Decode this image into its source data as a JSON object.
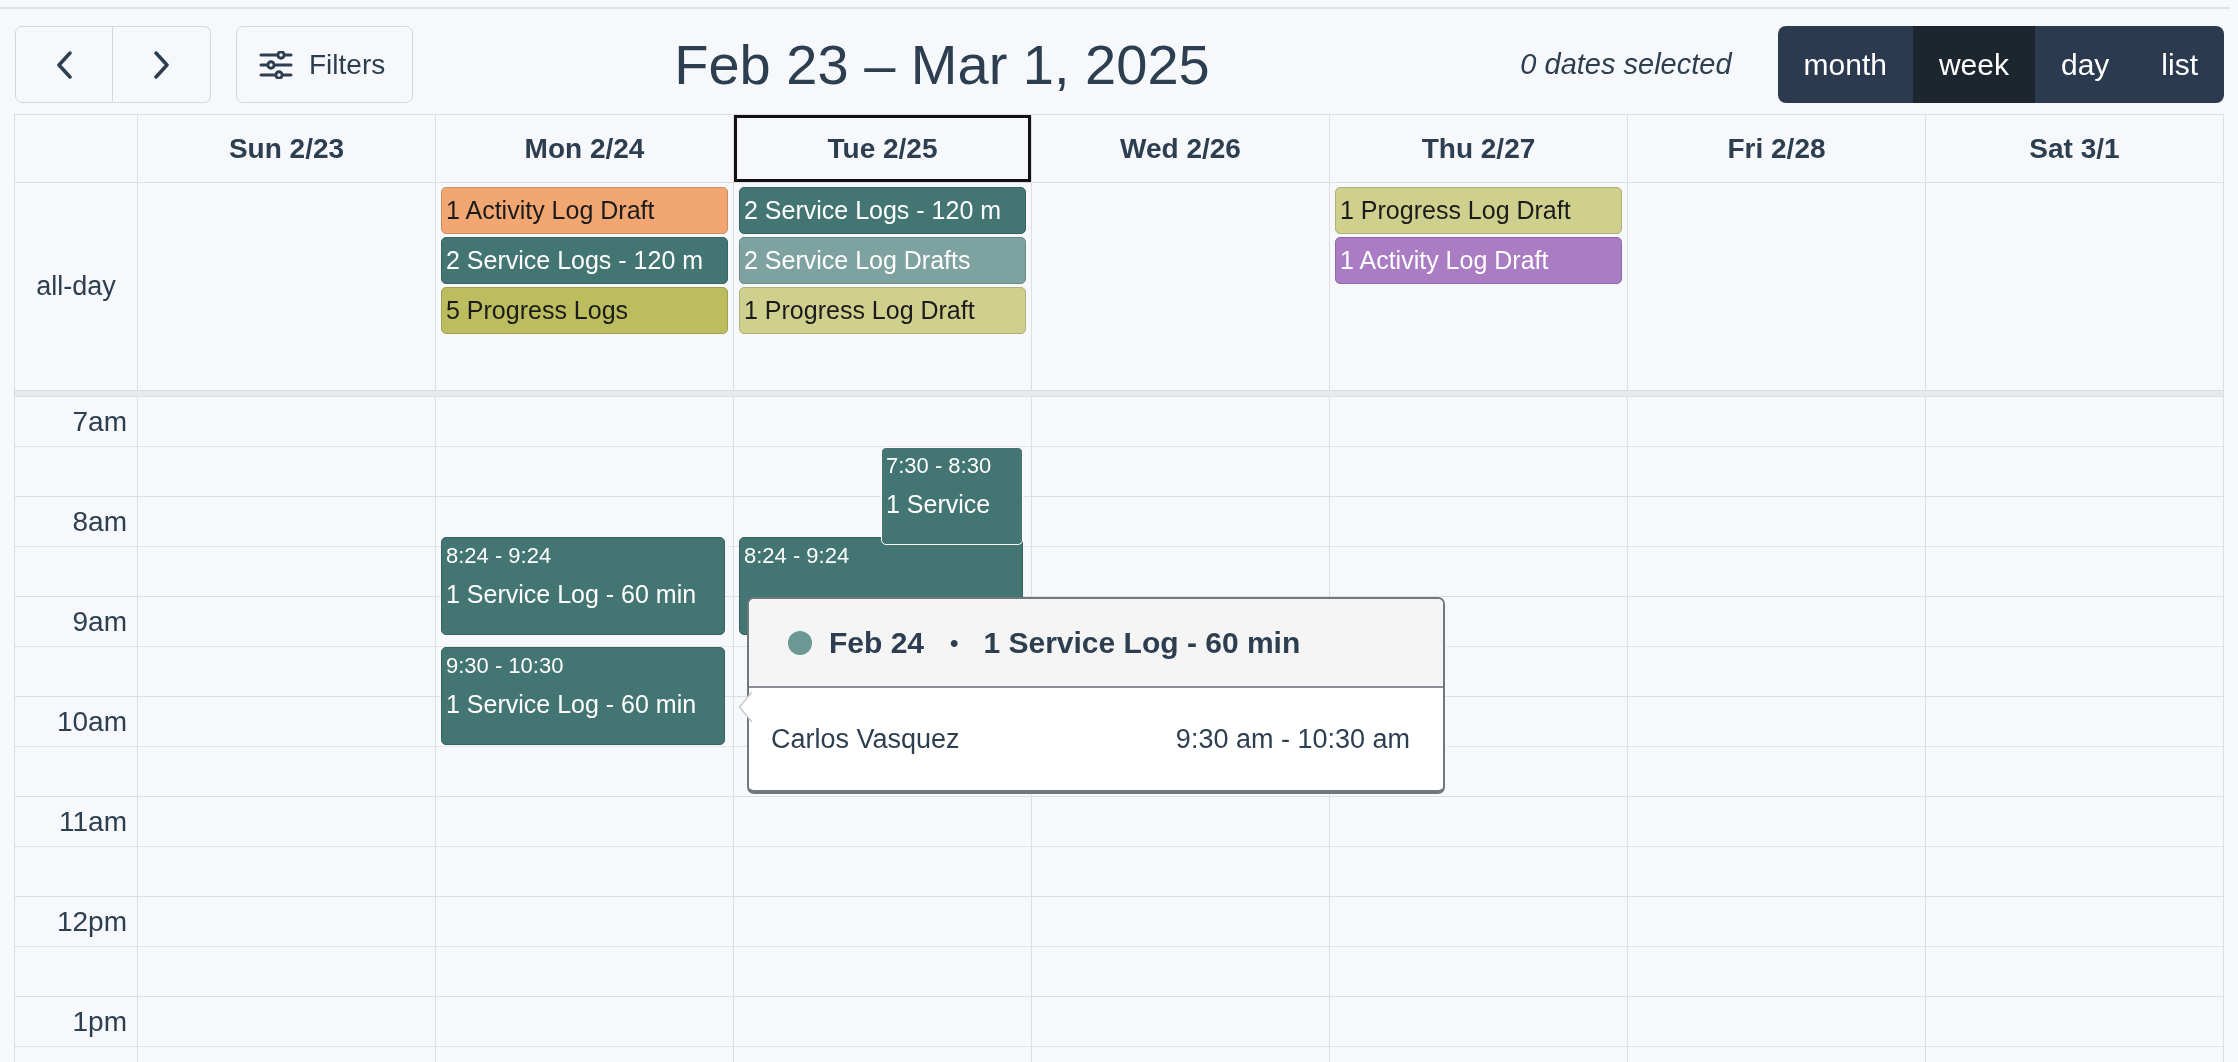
{
  "toolbar": {
    "filters_label": "Filters",
    "title": "Feb 23 – Mar 1, 2025",
    "selection_status": "0 dates selected",
    "views": [
      {
        "label": "month",
        "selected": false
      },
      {
        "label": "week",
        "selected": true
      },
      {
        "label": "day",
        "selected": false
      },
      {
        "label": "list",
        "selected": false
      }
    ]
  },
  "calendar": {
    "all_day_label": "all-day",
    "hours": [
      "7am",
      "8am",
      "9am",
      "10am",
      "11am",
      "12pm",
      "1pm"
    ],
    "days": [
      {
        "label": "Sun 2/23",
        "selected": false
      },
      {
        "label": "Mon 2/24",
        "selected": false,
        "all_day": [
          {
            "title": "1 Activity Log Draft",
            "color": "#f2a672"
          },
          {
            "title": "2 Service Logs - 120 m",
            "color": "#437572"
          },
          {
            "title": "5 Progress Logs",
            "color": "#bcbd5e"
          }
        ],
        "events": [
          {
            "time": "8:24 - 9:24",
            "title": "1 Service Log - 60 min",
            "color": "#437572"
          },
          {
            "time": "9:30 - 10:30",
            "title": "1 Service Log - 60 min",
            "color": "#437572"
          }
        ]
      },
      {
        "label": "Tue 2/25",
        "selected": true,
        "all_day": [
          {
            "title": "2 Service Logs - 120 m",
            "color": "#437572"
          },
          {
            "title": "2 Service Log Drafts",
            "color": "#7ea29f"
          },
          {
            "title": "1 Progress Log Draft",
            "color": "#cfd08e"
          }
        ],
        "events": [
          {
            "time": "7:30 - 8:30",
            "title": "1 Service",
            "color": "#437572"
          },
          {
            "time": "8:24 - 9:24",
            "color": "#437572"
          }
        ]
      },
      {
        "label": "Wed 2/26",
        "selected": false
      },
      {
        "label": "Thu 2/27",
        "selected": false,
        "all_day": [
          {
            "title": "1 Progress Log Draft",
            "color": "#cfd08e"
          },
          {
            "title": "1 Activity Log Draft",
            "color": "#a97cc4"
          }
        ]
      },
      {
        "label": "Fri 2/28",
        "selected": false
      },
      {
        "label": "Sat 3/1",
        "selected": false
      }
    ]
  },
  "popover": {
    "color": "#6b9894",
    "date": "Feb 24",
    "separator": "•",
    "title": "1 Service Log - 60 min",
    "person": "Carlos Vasquez",
    "time": "9:30 am - 10:30 am"
  }
}
